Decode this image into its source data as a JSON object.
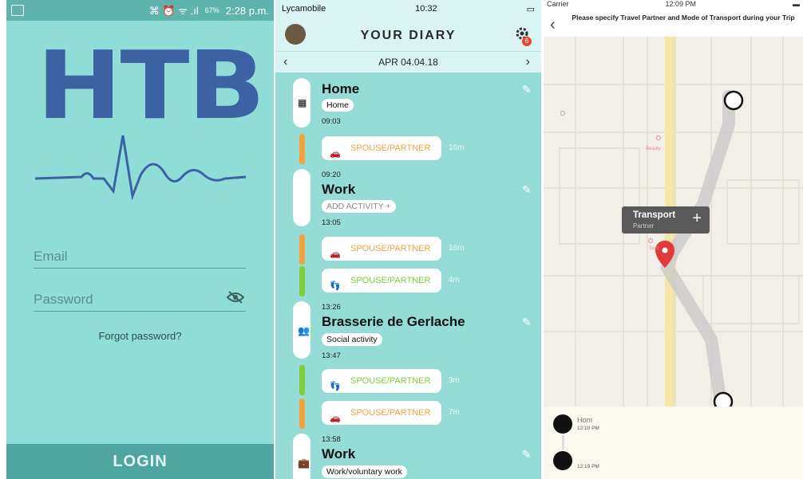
{
  "login_screen": {
    "status": {
      "icons": "⌘ ⏰ ᯤ .ıl",
      "battery": "67%",
      "time": "2:28 p.m."
    },
    "logo_text": "HTB",
    "email_placeholder": "Email",
    "password_placeholder": "Password",
    "forgot_password": "Forgot password?",
    "login_button": "LOGIN",
    "accent_color": "#3c62a4"
  },
  "diary_screen": {
    "status": {
      "carrier": "Lycamobile",
      "time": "10:32"
    },
    "title": "YOUR DIARY",
    "notification_count": "6",
    "date": "APR 04.04.18",
    "entries": [
      {
        "title": "Home",
        "tag": "Home",
        "end": "09:03"
      },
      {
        "trip_mode": "SPOUSE/PARTNER",
        "duration": "16m",
        "color": "#f2a33a"
      },
      {
        "start": "09:20",
        "title": "Work",
        "tag": "ADD ACTIVITY",
        "end": "13:05"
      },
      {
        "trip_mode": "SPOUSE/PARTNER",
        "duration": "16m",
        "color": "#f2a33a"
      },
      {
        "trip_mode": "SPOUSE/PARTNER",
        "duration": "4m",
        "color": "#7ccf3a"
      },
      {
        "start": "13:26",
        "title": "Brasserie de Gerlache",
        "tag": "Social activity",
        "end": "13:47"
      },
      {
        "trip_mode": "SPOUSE/PARTNER",
        "duration": "3m",
        "color": "#7ccf3a"
      },
      {
        "trip_mode": "SPOUSE/PARTNER",
        "duration": "7m",
        "color": "#f2a33a"
      },
      {
        "start": "13:58",
        "title": "Work",
        "tag": "Work/voluntary work"
      }
    ]
  },
  "map_screen": {
    "status": {
      "carrier": "Carrier",
      "time": "12:09 PM"
    },
    "prompt": "Please specify Travel Partner and Mode of Transport during your Trip",
    "popup": {
      "title": "Transport",
      "subtitle": "Partner"
    },
    "map_labels": [
      "Beauty",
      "Sent"
    ],
    "timeline": [
      {
        "label": "Hom",
        "time": "12:10 PM"
      },
      {
        "label": "",
        "time": "12:19 PM"
      }
    ]
  }
}
